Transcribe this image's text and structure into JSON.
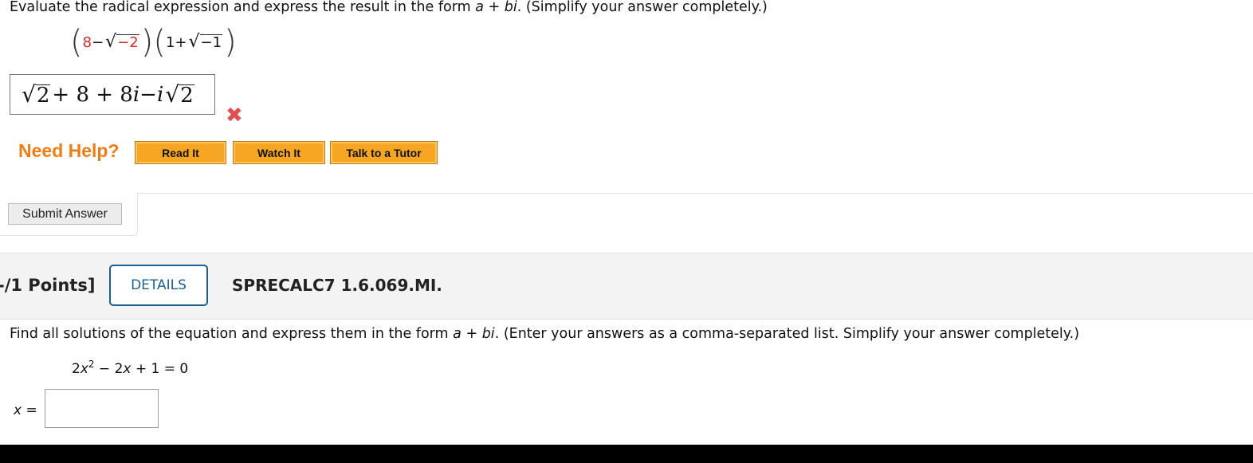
{
  "q1": {
    "instruction_pre": "Evaluate the radical expression and express the result in the form ",
    "form_a": "a",
    "form_plus": " + ",
    "form_bi": "bi",
    "instruction_post": ".  (Simplify your answer completely.)",
    "expression": {
      "first_term": "8",
      "minus": " − ",
      "radicand1": "−2",
      "one": "1",
      "plus": " + ",
      "radicand2": "−1"
    },
    "answer": {
      "rad1": "2",
      "mid": " + 8 + 8",
      "i1": "i",
      "minus": " − ",
      "i2": "i",
      "rad2": "2"
    },
    "status": "incorrect",
    "need_help_label": "Need Help?",
    "help_buttons": [
      "Read It",
      "Watch It",
      "Talk to a Tutor"
    ],
    "submit_label": "Submit Answer"
  },
  "q2": {
    "points_label": "-/1 Points]",
    "details_label": "DETAILS",
    "code": "SPRECALC7 1.6.069.MI.",
    "instruction_pre": "Find all solutions of the equation and express them in the form ",
    "form_a": "a",
    "form_plus": " + ",
    "form_bi": "bi",
    "instruction_post": ".  (Enter your answers as a comma-separated list. Simplify your answer completely.)",
    "equation": {
      "coef": "2",
      "var1": "x",
      "exp": "2",
      "rest1": " − 2",
      "var2": "x",
      "rest2": " + 1 = 0"
    },
    "x_label_var": "x",
    "x_label_eq": " =",
    "x_value": ""
  },
  "colors": {
    "help_orange": "#ef7d16",
    "button_orange": "#f6a623",
    "wrong_red": "#e05050",
    "details_blue": "#1f5f8f"
  }
}
